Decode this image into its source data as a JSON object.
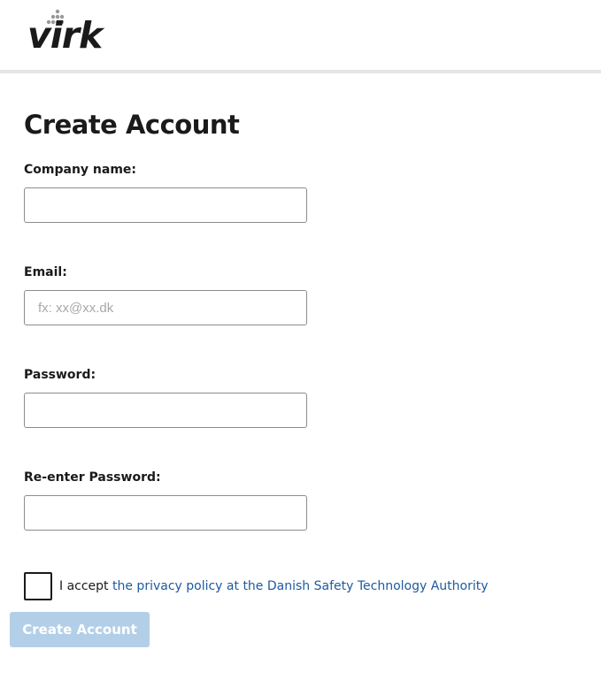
{
  "header": {
    "logo_text": "virk"
  },
  "form": {
    "title": "Create Account",
    "fields": {
      "company_name": {
        "label": "Company name:",
        "value": "",
        "placeholder": ""
      },
      "email": {
        "label": "Email:",
        "value": "",
        "placeholder": "fx: xx@xx.dk"
      },
      "password": {
        "label": "Password:",
        "value": "",
        "placeholder": ""
      },
      "reenter_password": {
        "label": "Re-enter Password:",
        "value": "",
        "placeholder": ""
      }
    },
    "accept": {
      "checked": false,
      "prefix": "I accept ",
      "link_text": "the privacy policy at the Danish Safety Technology Authority"
    },
    "submit_label": "Create Account"
  },
  "colors": {
    "link": "#1e5aa0",
    "button_disabled_bg": "#b3cfe8",
    "header_divider": "#e6e6e6"
  },
  "icons": {
    "logo_dots": "dots-triangle-icon"
  }
}
